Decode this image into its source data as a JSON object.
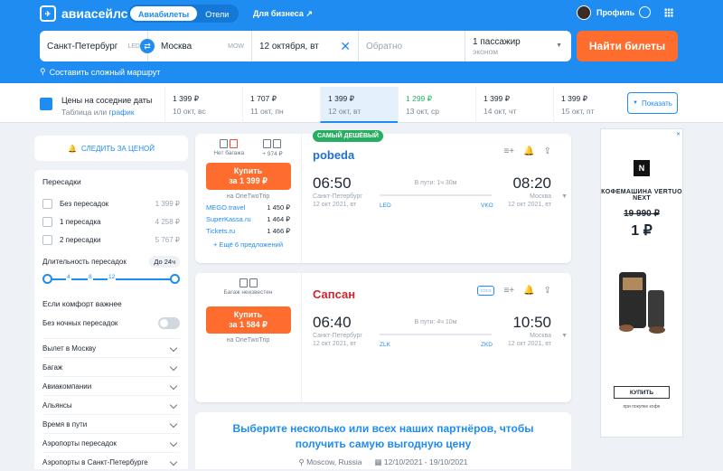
{
  "header": {
    "logo_text": "авиасейлс",
    "tabs": [
      "Авиабилеты",
      "Отели"
    ],
    "business_link": "Для бизнеса ↗",
    "profile_label": "Профиль"
  },
  "search": {
    "from_city": "Санкт-Петербург",
    "from_code": "LED",
    "to_city": "Москва",
    "to_code": "MOW",
    "depart_date": "12 октября, вт",
    "return_placeholder": "Обратно",
    "passengers": "1 пассажир",
    "cabin": "эконом",
    "find_button": "Найти билеты",
    "complex_route": "Составить сложный маршрут"
  },
  "price_strip": {
    "title": "Цены на соседние даты",
    "sub_table": "Таблица",
    "sub_or": "или",
    "sub_chart": "график",
    "cells": [
      {
        "price": "1 399 ₽",
        "date": "10 окт, вс"
      },
      {
        "price": "1 707 ₽",
        "date": "11 окт, пн"
      },
      {
        "price": "1 399 ₽",
        "date": "12 окт, вт"
      },
      {
        "price": "1 299 ₽",
        "date": "13 окт, ср"
      },
      {
        "price": "1 399 ₽",
        "date": "14 окт, чт"
      },
      {
        "price": "1 399 ₽",
        "date": "15 окт, пт"
      }
    ],
    "selected_index": 2,
    "cheapest_index": 3,
    "show_button": "Показать"
  },
  "filters": {
    "price_alert": "СЛЕДИТЬ ЗА ЦЕНОЙ",
    "transfers_title": "Пересадки",
    "transfers": [
      {
        "label": "Без пересадок",
        "price": "1 399 ₽"
      },
      {
        "label": "1 пересадка",
        "price": "4 258 ₽"
      },
      {
        "label": "2 пересадки",
        "price": "5 767 ₽"
      }
    ],
    "duration_label": "Длительность пересадок",
    "duration_value": "До 24ч",
    "duration_ticks": [
      "4",
      "8",
      "12"
    ],
    "comfort_title": "Если комфорт важнее",
    "no_night": "Без ночных пересадок",
    "sections": [
      "Вылет в Москву",
      "Багаж",
      "Авиакомпании",
      "Альянсы",
      "Время в пути",
      "Аэропорты пересадок",
      "Аэропорты в Санкт-Петербурге"
    ]
  },
  "tickets": [
    {
      "badge": "САМЫЙ ДЕШЁВЫЙ",
      "bag_left": "Нет багажа",
      "bag_right": "+ 974 ₽",
      "buy_label": "Купить",
      "buy_price": "за 1 399 ₽",
      "via": "на OneTwoTrip",
      "agencies": [
        {
          "name": "MEGO.travel",
          "price": "1 450 ₽"
        },
        {
          "name": "SuperKassa.ru",
          "price": "1 464 ₽"
        },
        {
          "name": "Tickets.ru",
          "price": "1 466 ₽"
        }
      ],
      "more": "+ Ещё 6 предложений",
      "airline": "pobeda",
      "dep_time": "06:50",
      "arr_time": "08:20",
      "dep_city": "Санкт-Петербург",
      "dep_date": "12 окт 2021, вт",
      "arr_city": "Москва",
      "arr_date": "12 окт 2021, вт",
      "duration": "В пути: 1ч 30м",
      "dep_code": "LED",
      "arr_code": "VKO"
    },
    {
      "bag_left": "Багаж неизвестен",
      "buy_label": "Купить",
      "buy_price": "за 1 584 ₽",
      "via": "на OneTwoTrip",
      "airline": "Сапсан",
      "dep_time": "06:40",
      "arr_time": "10:50",
      "dep_city": "Санкт-Петербург",
      "dep_date": "12 окт 2021, вт",
      "arr_city": "Москва",
      "arr_date": "12 окт 2021, вт",
      "duration": "В пути: 4ч 10м",
      "dep_code": "ZLK",
      "arr_code": "ZKD"
    }
  ],
  "promo": {
    "heading": "Выберите несколько или всех наших партнёров, чтобы получить самую выгодную цену",
    "location": "Moscow, Russia",
    "dates": "12/10/2021 - 19/10/2021"
  },
  "ad": {
    "title": "КОФЕМАШИНА VERTUO NEXT",
    "old_price": "19 990 ₽",
    "new_price": "1 ₽",
    "button": "КУПИТЬ",
    "note": "при покупке кофе"
  },
  "colors": {
    "brand": "#1f8cf2",
    "cta": "#ff6d2e",
    "good": "#27ae60"
  }
}
